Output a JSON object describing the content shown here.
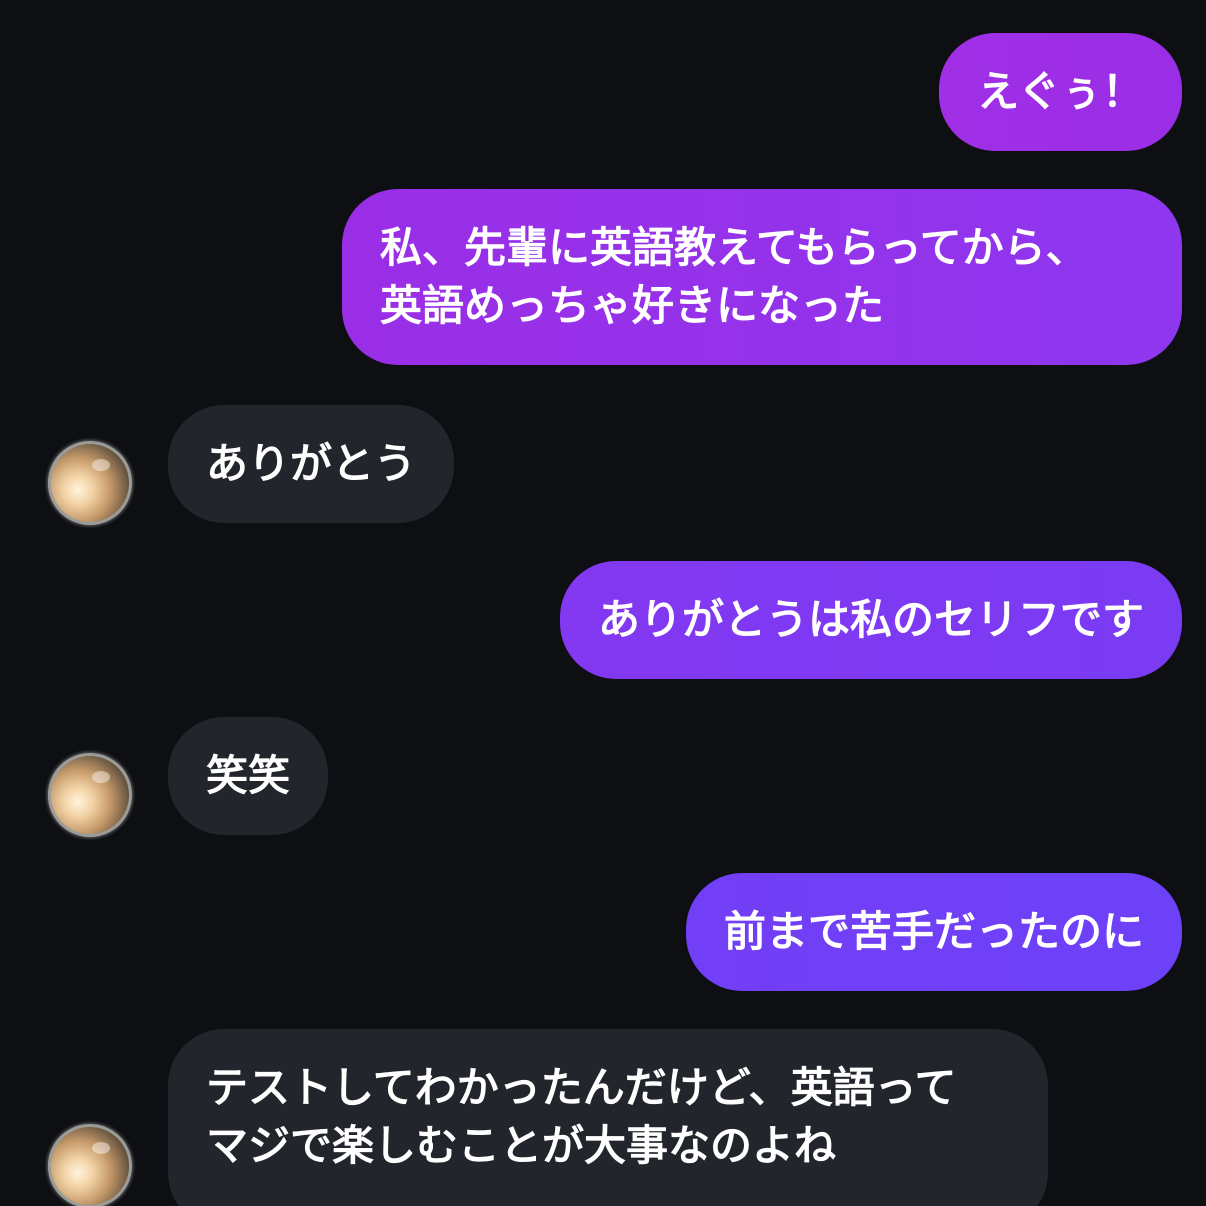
{
  "conversation": {
    "messages": [
      {
        "sender": "me",
        "text": "えぐぅ！"
      },
      {
        "sender": "me",
        "text": "私、先輩に英語教えてもらってから、\n英語めっちゃ好きになった"
      },
      {
        "sender": "other",
        "text": "ありがとう"
      },
      {
        "sender": "me",
        "text": "ありがとうは私のセリフです"
      },
      {
        "sender": "other",
        "text": "笑笑"
      },
      {
        "sender": "me",
        "text": "前まで苦手だったのに"
      },
      {
        "sender": "other",
        "text": "テストしてわかったんだけど、英語って\nマジで楽しむことが大事なのよね"
      }
    ]
  },
  "colors": {
    "background": "#0d0f13",
    "sent_bubble_top": "#a02fe6",
    "sent_bubble_bottom": "#6d41f8",
    "received_bubble": "#22252b",
    "text": "#ffffff"
  }
}
